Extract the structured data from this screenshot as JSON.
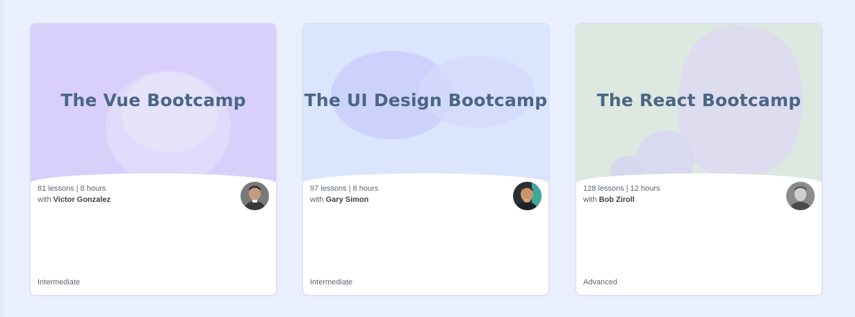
{
  "cards": [
    {
      "title": "The Vue Bootcamp",
      "stats": "81 lessons | 8 hours",
      "with_label": "with",
      "instructor": "Victor Gonzalez",
      "level": "Intermediate",
      "banner_color": "#d8d0fb",
      "avatar_icon": "instructor-photo"
    },
    {
      "title": "The UI Design Bootcamp",
      "stats": "97 lessons | 8 hours",
      "with_label": "with",
      "instructor": "Gary Simon",
      "level": "Intermediate",
      "banner_color": "#dbe5fd",
      "avatar_icon": "instructor-photo"
    },
    {
      "title": "The React Bootcamp",
      "stats": "128 lessons | 12 hours",
      "with_label": "with",
      "instructor": "Bob Ziroll",
      "level": "Advanced",
      "banner_color": "#dde9e0",
      "avatar_icon": "instructor-photo"
    }
  ],
  "colors": {
    "page_background": "#e9effd",
    "title_text": "#4a6685"
  }
}
